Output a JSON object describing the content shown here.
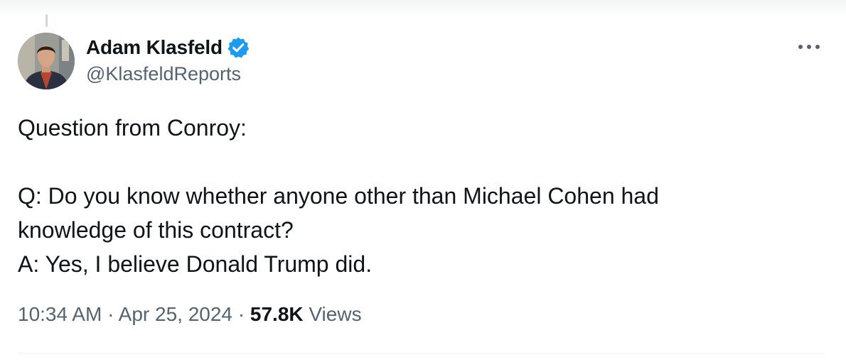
{
  "tweet": {
    "author": {
      "display_name": "Adam Klasfeld",
      "handle": "@KlasfeldReports",
      "verified": true
    },
    "text_lines": [
      "Question from Conroy:",
      "",
      "Q: Do you know whether anyone other than Michael Cohen had",
      "knowledge of this contract?",
      "A: Yes, I believe Donald Trump did."
    ],
    "time": "10:34 AM",
    "date": "Apr 25, 2024",
    "separator": "·",
    "views_count": "57.8K",
    "views_label": "Views"
  },
  "icons": {
    "verified": "verified-badge-icon",
    "more": "more-options-icon"
  },
  "colors": {
    "verified_blue": "#1d9bf0",
    "text_primary": "#0f1419",
    "text_secondary": "#536471"
  }
}
